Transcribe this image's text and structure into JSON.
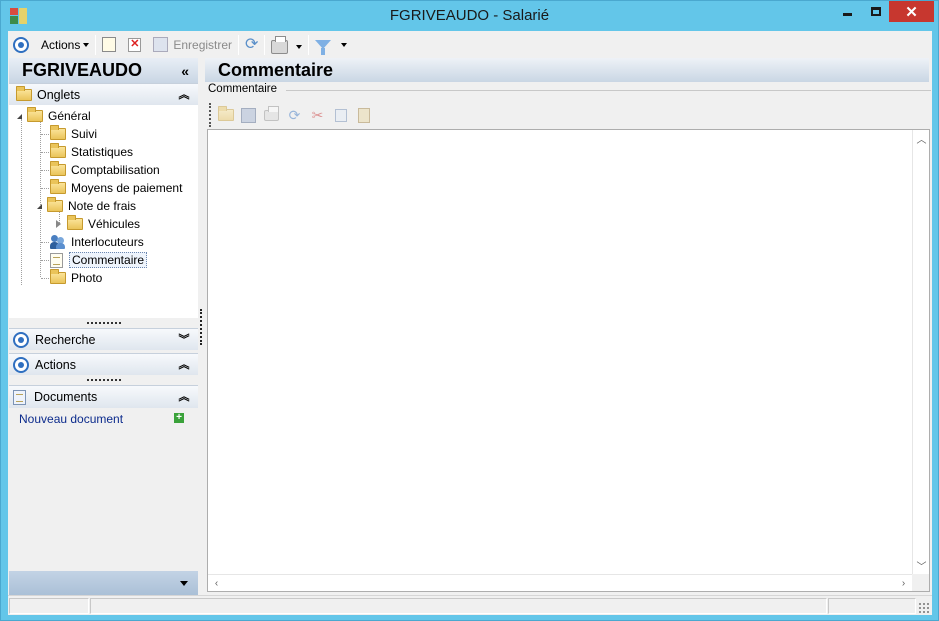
{
  "window": {
    "title": "FGRIVEAUDO -  Salarié",
    "close_glyph": "✕"
  },
  "toolbar": {
    "actions_label": "Actions",
    "save_label": "Enregistrer"
  },
  "left": {
    "title": "FGRIVEAUDO",
    "collapse_glyph": "«",
    "onglets_label": "Onglets",
    "tree": {
      "general": "Général",
      "suivi": "Suivi",
      "statistiques": "Statistiques",
      "comptabilisation": "Comptabilisation",
      "moyens": "Moyens de paiement",
      "note_frais": "Note de frais",
      "vehicules": "Véhicules",
      "interlocuteurs": "Interlocuteurs",
      "commentaire": "Commentaire",
      "photo": "Photo"
    },
    "recherche_label": "Recherche",
    "actions_label": "Actions",
    "documents_label": "Documents",
    "new_document": "Nouveau document"
  },
  "main": {
    "title": "Commentaire",
    "group_label": "Commentaire"
  },
  "colors": {
    "frame": "#63c6e9",
    "close_button": "#c7372f",
    "link": "#0c2b8c"
  }
}
